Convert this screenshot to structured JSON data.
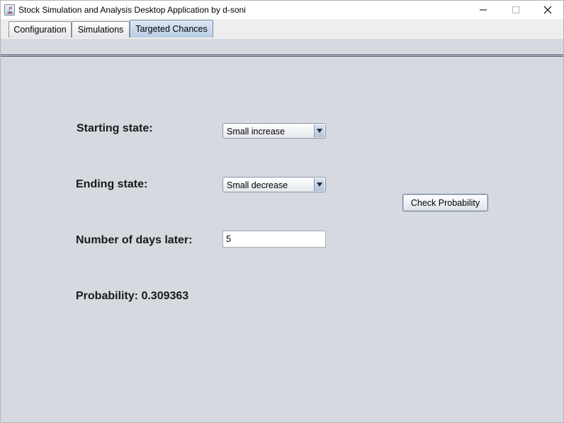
{
  "window": {
    "title": "Stock Simulation and Analysis Desktop Application by d-soni"
  },
  "tabs": [
    {
      "label": "Configuration",
      "active": false
    },
    {
      "label": "Simulations",
      "active": false
    },
    {
      "label": "Targeted Chances",
      "active": true
    }
  ],
  "form": {
    "starting_state_label": "Starting state:",
    "starting_state_value": "Small increase",
    "ending_state_label": "Ending state:",
    "ending_state_value": "Small decrease",
    "days_label": "Number of days later:",
    "days_value": "5",
    "check_button_label": "Check Probability",
    "probability_text": "Probability: 0.309363"
  },
  "colors": {
    "panel_bg": "#d6d9df",
    "active_tab": "#b9cde3"
  }
}
